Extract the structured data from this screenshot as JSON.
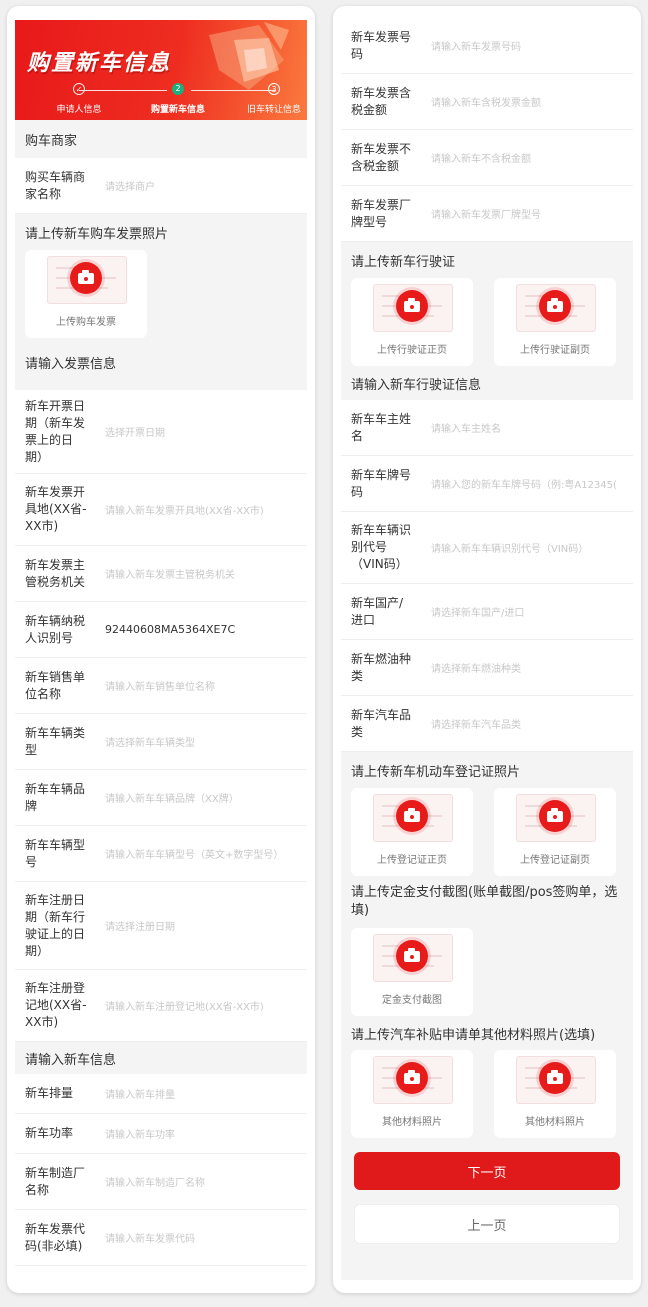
{
  "header": {
    "title": "购置新车信息",
    "steps": [
      {
        "num": "",
        "label": "申请人信息"
      },
      {
        "num": "2",
        "label": "购置新车信息"
      },
      {
        "num": "3",
        "label": "旧车转让信息"
      }
    ]
  },
  "dealer": {
    "section": "购车商家",
    "rows": [
      {
        "label": "购买车辆商家名称",
        "value": "请选择商户"
      }
    ]
  },
  "invoice_upload": {
    "section": "请上传新车购车发票照片",
    "tiles": [
      {
        "label": "上传购车发票"
      }
    ]
  },
  "invoice_info": {
    "section": "请输入发票信息",
    "rows": [
      {
        "label": "新车开票日期（新车发票上的日期）",
        "value": "选择开票日期"
      },
      {
        "label": "新车发票开具地(XX省-XX市)",
        "value": "请输入新车发票开具地(XX省-XX市)"
      },
      {
        "label": "新车发票主管税务机关",
        "value": "请输入新车发票主管税务机关"
      },
      {
        "label": "新车辆纳税人识别号",
        "value": "92440608MA5364XE7C"
      },
      {
        "label": "新车销售单位名称",
        "value": "请输入新车销售单位名称"
      },
      {
        "label": "新车车辆类型",
        "value": "请选择新车车辆类型"
      },
      {
        "label": "新车车辆品牌",
        "value": "请输入新车车辆品牌（XX牌）"
      },
      {
        "label": "新车车辆型号",
        "value": "请输入新车车辆型号（英文+数字型号）"
      },
      {
        "label": "新车注册日期（新车行驶证上的日期）",
        "value": "请选择注册日期"
      },
      {
        "label": "新车注册登记地(XX省-XX市)",
        "value": "请输入新车注册登记地(XX省-XX市)"
      }
    ]
  },
  "newcar_info": {
    "section": "请输入新车信息",
    "rows": [
      {
        "label": "新车排量",
        "value": "请输入新车排量"
      },
      {
        "label": "新车功率",
        "value": "请输入新车功率"
      },
      {
        "label": "新车制造厂名称",
        "value": "请输入新车制造厂名称"
      },
      {
        "label": "新车发票代码(非必填)",
        "value": "请输入新车发票代码"
      }
    ]
  },
  "invoice_more": {
    "rows": [
      {
        "label": "新车发票号码",
        "value": "请输入新车发票号码"
      },
      {
        "label": "新车发票含税金额",
        "value": "请输入新车含税发票金额"
      },
      {
        "label": "新车发票不含税金额",
        "value": "请输入新车不含税金额"
      },
      {
        "label": "新车发票厂牌型号",
        "value": "请输入新车发票厂牌型号"
      }
    ]
  },
  "license_upload": {
    "section": "请上传新车行驶证",
    "tiles": [
      {
        "label": "上传行驶证正页"
      },
      {
        "label": "上传行驶证副页"
      }
    ]
  },
  "license_info": {
    "section": "请输入新车行驶证信息",
    "rows": [
      {
        "label": "新车车主姓名",
        "value": "请输入车主姓名"
      },
      {
        "label": "新车车牌号码",
        "value": "请输入您的新车车牌号码（例:粤A12345("
      },
      {
        "label": "新车车辆识别代号（VIN码）",
        "value": "请输入新车车辆识别代号（VIN码）"
      },
      {
        "label": "新车国产/进口",
        "value": "请选择新车国产/进口"
      },
      {
        "label": "新车燃油种类",
        "value": "请选择新车燃油种类"
      },
      {
        "label": "新车汽车品类",
        "value": "请选择新车汽车品类"
      }
    ]
  },
  "registration_upload": {
    "section": "请上传新车机动车登记证照片",
    "tiles": [
      {
        "label": "上传登记证正页"
      },
      {
        "label": "上传登记证副页"
      }
    ]
  },
  "deposit_upload": {
    "section": "请上传定金支付截图(账单截图/pos签购单，选填)",
    "tiles": [
      {
        "label": "定金支付截图"
      }
    ]
  },
  "subsidy_upload": {
    "section": "请上传汽车补贴申请单其他材料照片(选填)",
    "tiles": [
      {
        "label": "其他材料照片"
      },
      {
        "label": "其他材料照片"
      }
    ]
  },
  "buttons": {
    "next": "下一页",
    "prev": "上一页"
  },
  "colors": {
    "primary": "#e0191a",
    "banner_start": "#e8191a",
    "banner_end": "#fb7a3e",
    "section_bg": "#f4f4f4"
  }
}
